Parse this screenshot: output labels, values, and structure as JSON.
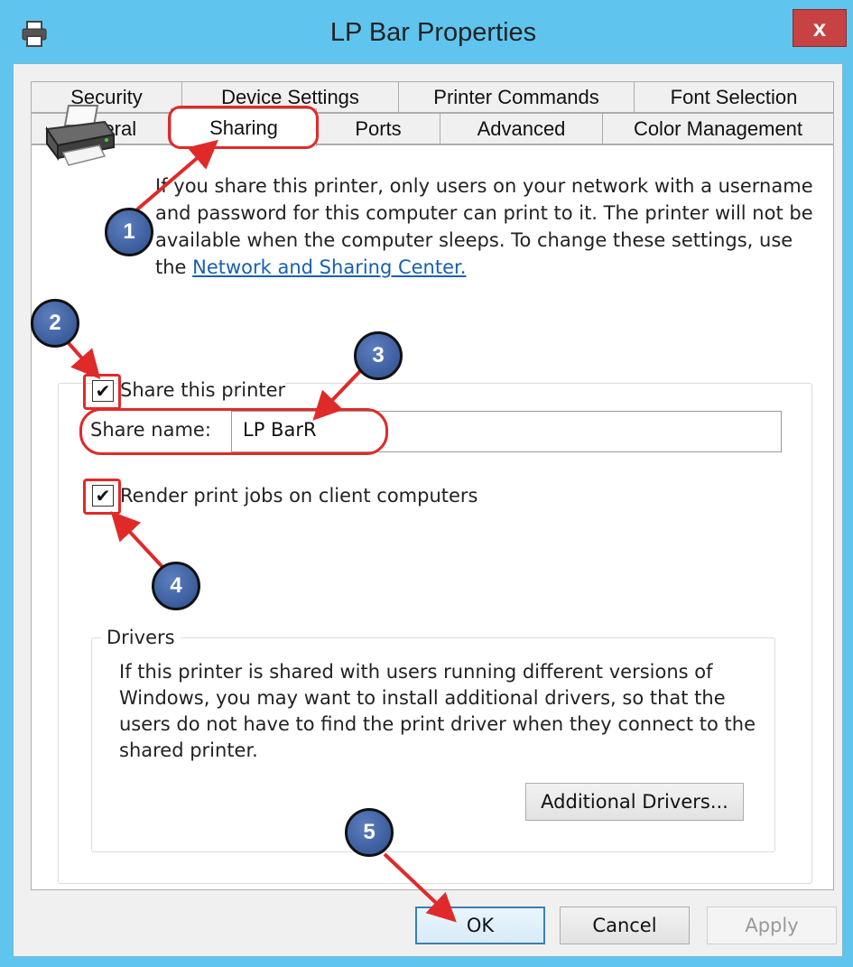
{
  "window": {
    "title": "LP Bar Properties",
    "close_label": "x"
  },
  "tabs": {
    "row1": [
      "Security",
      "Device Settings",
      "Printer Commands",
      "Font Selection"
    ],
    "row2": [
      "General",
      "Sharing",
      "Ports",
      "Advanced",
      "Color Management"
    ],
    "active": "Sharing"
  },
  "sharing": {
    "intro_text": "If you share this printer, only users on your network with a username and password for this computer can print to it. The printer will not be available when the computer sleeps. To change these settings, use the ",
    "intro_link": "Network and Sharing Center.",
    "share_printer_label": "Share this printer",
    "share_printer_checked": true,
    "share_name_label": "Share name:",
    "share_name_value": "LP BarR",
    "render_jobs_label": "Render print jobs on client computers",
    "render_jobs_checked": true
  },
  "drivers": {
    "legend": "Drivers",
    "text": "If this printer is shared with users running different versions of Windows, you may want to install additional drivers, so that the users do not have to find the print driver when they connect to the shared printer.",
    "additional_button": "Additional Drivers..."
  },
  "footer": {
    "ok": "OK",
    "cancel": "Cancel",
    "apply": "Apply"
  },
  "annotations": [
    "1",
    "2",
    "3",
    "4",
    "5"
  ],
  "icons": {
    "title": "printer-icon",
    "panel": "printer-icon",
    "check": "✔"
  },
  "colors": {
    "title_bar": "#5fc5ef",
    "close_button": "#c74343",
    "annotation_red": "#e02a2a",
    "callout_blue": "#2d4d8e"
  }
}
